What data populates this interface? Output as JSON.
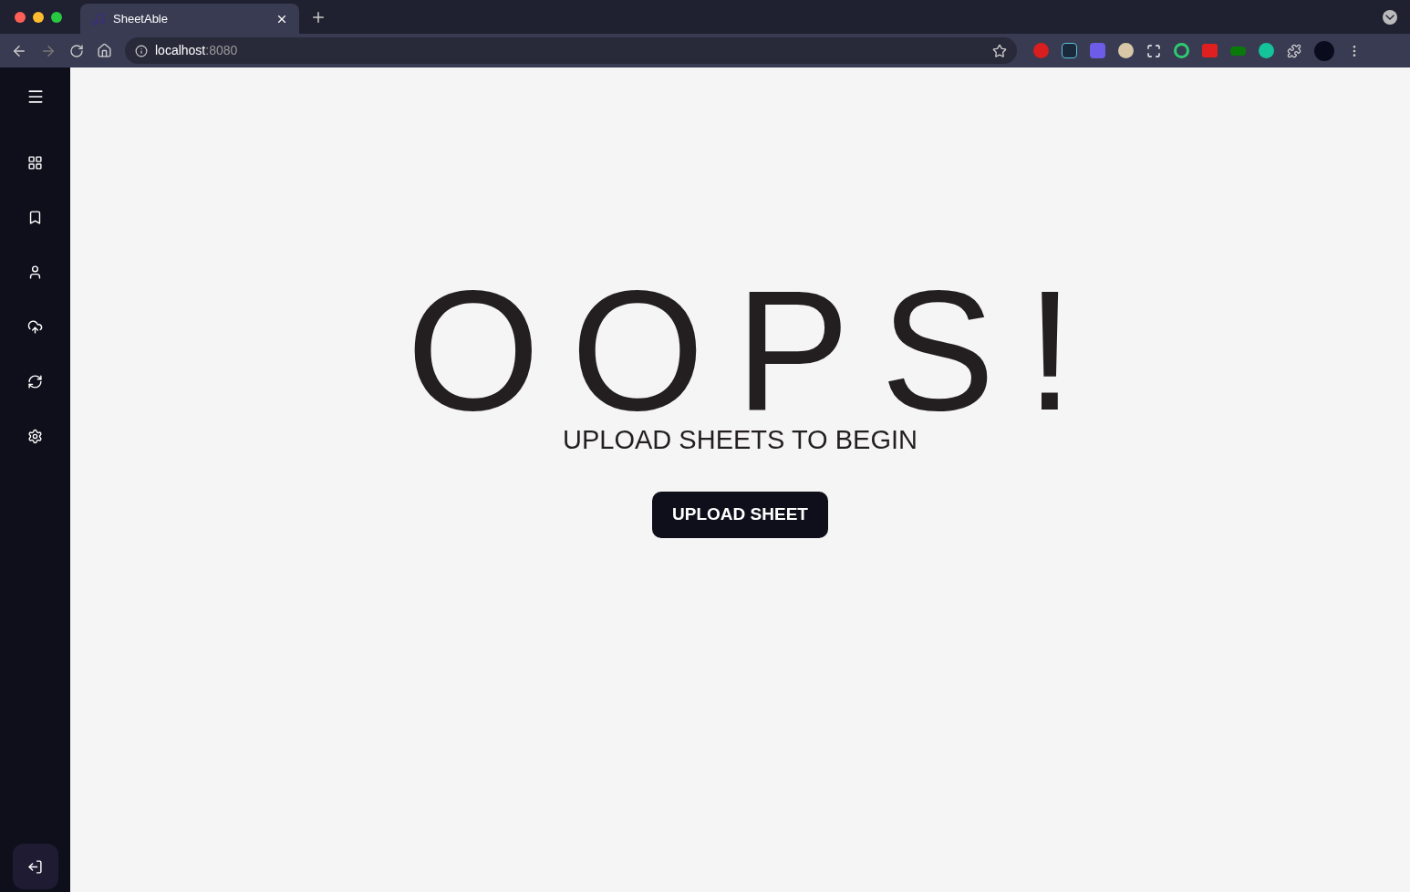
{
  "browser": {
    "tab_title": "SheetAble",
    "url_host": "localhost",
    "url_port": ":8080"
  },
  "main": {
    "headline": "OOPS!",
    "subtitle": "UPLOAD SHEETS TO BEGIN",
    "button": "UPLOAD SHEET"
  }
}
